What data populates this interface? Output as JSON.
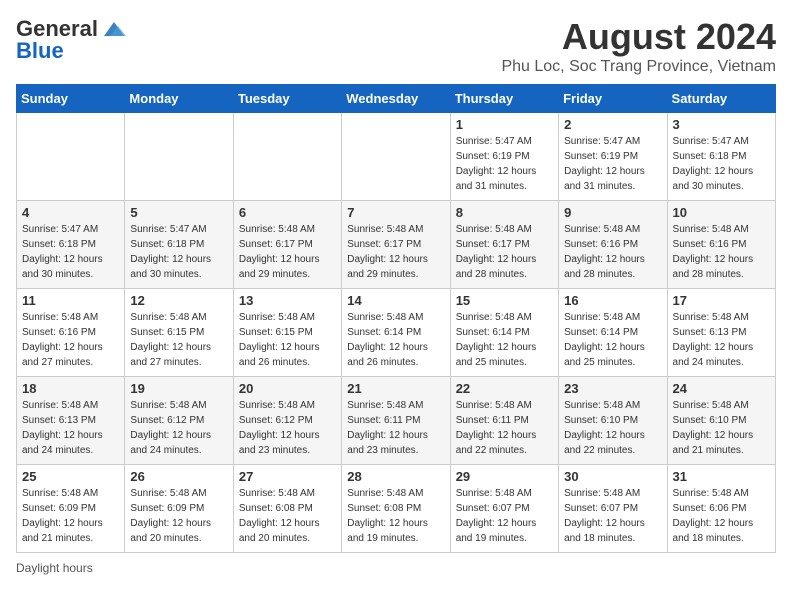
{
  "header": {
    "logo_general": "General",
    "logo_blue": "Blue",
    "title": "August 2024",
    "subtitle": "Phu Loc, Soc Trang Province, Vietnam"
  },
  "weekdays": [
    "Sunday",
    "Monday",
    "Tuesday",
    "Wednesday",
    "Thursday",
    "Friday",
    "Saturday"
  ],
  "weeks": [
    [
      {
        "day": "",
        "info": ""
      },
      {
        "day": "",
        "info": ""
      },
      {
        "day": "",
        "info": ""
      },
      {
        "day": "",
        "info": ""
      },
      {
        "day": "1",
        "info": "Sunrise: 5:47 AM\nSunset: 6:19 PM\nDaylight: 12 hours and 31 minutes."
      },
      {
        "day": "2",
        "info": "Sunrise: 5:47 AM\nSunset: 6:19 PM\nDaylight: 12 hours and 31 minutes."
      },
      {
        "day": "3",
        "info": "Sunrise: 5:47 AM\nSunset: 6:18 PM\nDaylight: 12 hours and 30 minutes."
      }
    ],
    [
      {
        "day": "4",
        "info": "Sunrise: 5:47 AM\nSunset: 6:18 PM\nDaylight: 12 hours and 30 minutes."
      },
      {
        "day": "5",
        "info": "Sunrise: 5:47 AM\nSunset: 6:18 PM\nDaylight: 12 hours and 30 minutes."
      },
      {
        "day": "6",
        "info": "Sunrise: 5:48 AM\nSunset: 6:17 PM\nDaylight: 12 hours and 29 minutes."
      },
      {
        "day": "7",
        "info": "Sunrise: 5:48 AM\nSunset: 6:17 PM\nDaylight: 12 hours and 29 minutes."
      },
      {
        "day": "8",
        "info": "Sunrise: 5:48 AM\nSunset: 6:17 PM\nDaylight: 12 hours and 28 minutes."
      },
      {
        "day": "9",
        "info": "Sunrise: 5:48 AM\nSunset: 6:16 PM\nDaylight: 12 hours and 28 minutes."
      },
      {
        "day": "10",
        "info": "Sunrise: 5:48 AM\nSunset: 6:16 PM\nDaylight: 12 hours and 28 minutes."
      }
    ],
    [
      {
        "day": "11",
        "info": "Sunrise: 5:48 AM\nSunset: 6:16 PM\nDaylight: 12 hours and 27 minutes."
      },
      {
        "day": "12",
        "info": "Sunrise: 5:48 AM\nSunset: 6:15 PM\nDaylight: 12 hours and 27 minutes."
      },
      {
        "day": "13",
        "info": "Sunrise: 5:48 AM\nSunset: 6:15 PM\nDaylight: 12 hours and 26 minutes."
      },
      {
        "day": "14",
        "info": "Sunrise: 5:48 AM\nSunset: 6:14 PM\nDaylight: 12 hours and 26 minutes."
      },
      {
        "day": "15",
        "info": "Sunrise: 5:48 AM\nSunset: 6:14 PM\nDaylight: 12 hours and 25 minutes."
      },
      {
        "day": "16",
        "info": "Sunrise: 5:48 AM\nSunset: 6:14 PM\nDaylight: 12 hours and 25 minutes."
      },
      {
        "day": "17",
        "info": "Sunrise: 5:48 AM\nSunset: 6:13 PM\nDaylight: 12 hours and 24 minutes."
      }
    ],
    [
      {
        "day": "18",
        "info": "Sunrise: 5:48 AM\nSunset: 6:13 PM\nDaylight: 12 hours and 24 minutes."
      },
      {
        "day": "19",
        "info": "Sunrise: 5:48 AM\nSunset: 6:12 PM\nDaylight: 12 hours and 24 minutes."
      },
      {
        "day": "20",
        "info": "Sunrise: 5:48 AM\nSunset: 6:12 PM\nDaylight: 12 hours and 23 minutes."
      },
      {
        "day": "21",
        "info": "Sunrise: 5:48 AM\nSunset: 6:11 PM\nDaylight: 12 hours and 23 minutes."
      },
      {
        "day": "22",
        "info": "Sunrise: 5:48 AM\nSunset: 6:11 PM\nDaylight: 12 hours and 22 minutes."
      },
      {
        "day": "23",
        "info": "Sunrise: 5:48 AM\nSunset: 6:10 PM\nDaylight: 12 hours and 22 minutes."
      },
      {
        "day": "24",
        "info": "Sunrise: 5:48 AM\nSunset: 6:10 PM\nDaylight: 12 hours and 21 minutes."
      }
    ],
    [
      {
        "day": "25",
        "info": "Sunrise: 5:48 AM\nSunset: 6:09 PM\nDaylight: 12 hours and 21 minutes."
      },
      {
        "day": "26",
        "info": "Sunrise: 5:48 AM\nSunset: 6:09 PM\nDaylight: 12 hours and 20 minutes."
      },
      {
        "day": "27",
        "info": "Sunrise: 5:48 AM\nSunset: 6:08 PM\nDaylight: 12 hours and 20 minutes."
      },
      {
        "day": "28",
        "info": "Sunrise: 5:48 AM\nSunset: 6:08 PM\nDaylight: 12 hours and 19 minutes."
      },
      {
        "day": "29",
        "info": "Sunrise: 5:48 AM\nSunset: 6:07 PM\nDaylight: 12 hours and 19 minutes."
      },
      {
        "day": "30",
        "info": "Sunrise: 5:48 AM\nSunset: 6:07 PM\nDaylight: 12 hours and 18 minutes."
      },
      {
        "day": "31",
        "info": "Sunrise: 5:48 AM\nSunset: 6:06 PM\nDaylight: 12 hours and 18 minutes."
      }
    ]
  ],
  "footer": {
    "daylight_label": "Daylight hours"
  }
}
